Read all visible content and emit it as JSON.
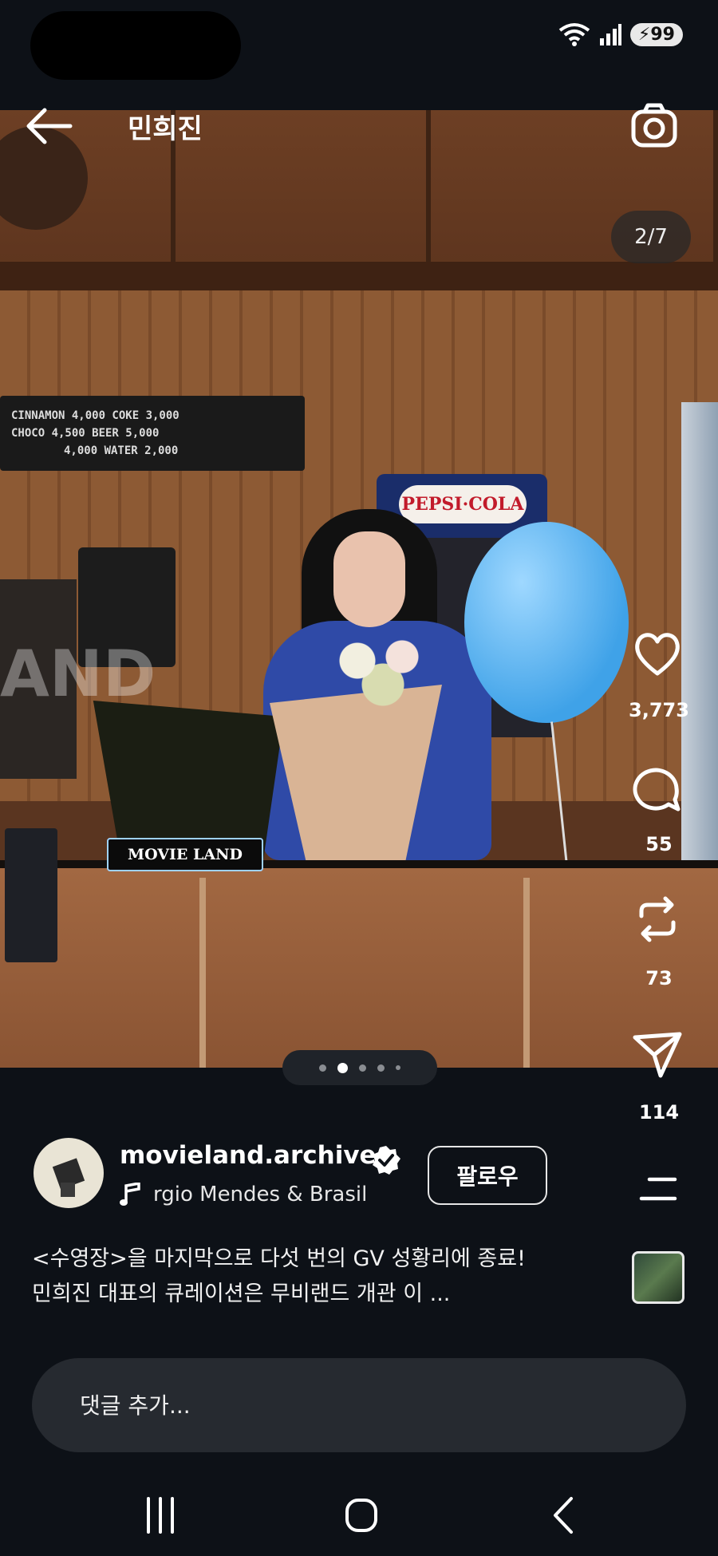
{
  "status_bar": {
    "battery": "99"
  },
  "header": {
    "title": "민희진"
  },
  "media": {
    "counter": "2/7",
    "menu_board": [
      "CINNAMON 4,000  COKE 3,000",
      "CHOCO 4,500  BEER 5,000",
      "4,000  WATER 2,000"
    ],
    "counter_sign": "MOVIE LAND",
    "watermark": "AND",
    "pepsi_text": "PEPSI·COLA"
  },
  "rail": {
    "likes": "3,773",
    "comments": "55",
    "reposts": "73",
    "shares": "114"
  },
  "carousel": {
    "total": 5,
    "active": 1
  },
  "post": {
    "username": "movieland.archive",
    "music": "rgio Mendes & Brasil",
    "follow_label": "팔로우",
    "caption_line1": "<수영장>을 마지막으로 다섯 번의 GV 성황리에 종료!",
    "caption_line2": "민희진 대표의 큐레이션은 무비랜드 개관 이 ..."
  },
  "comment": {
    "placeholder": "댓글 추가..."
  },
  "colors": {
    "background": "#0d1117",
    "accent": "#ffffff",
    "input_bg": "#262a30"
  }
}
